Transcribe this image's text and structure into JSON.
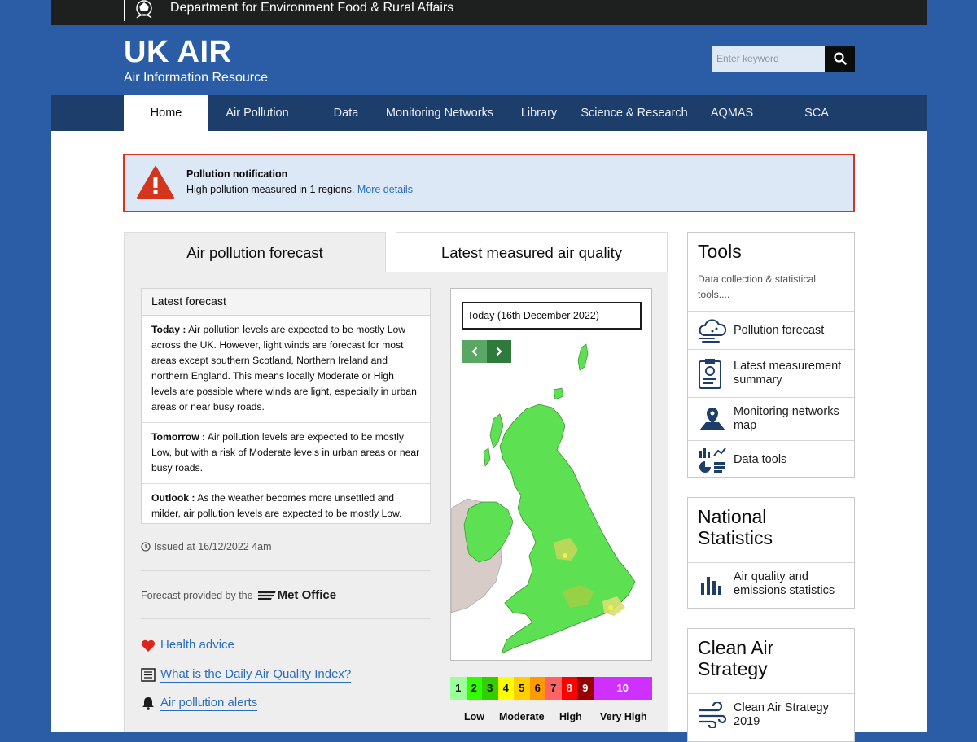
{
  "topbar": {
    "department": "Department for Environment Food & Rural Affairs"
  },
  "header": {
    "title": "UK AIR",
    "subtitle": "Air Information Resource",
    "search": {
      "placeholder": "Enter keyword"
    }
  },
  "nav": {
    "items": [
      {
        "label": "Home",
        "active": true
      },
      {
        "label": "Air Pollution"
      },
      {
        "label": "Data"
      },
      {
        "label": "Monitoring Networks"
      },
      {
        "label": "Library"
      },
      {
        "label": "Science & Research"
      },
      {
        "label": "AQMAS"
      },
      {
        "label": "SCA"
      }
    ]
  },
  "alert": {
    "title": "Pollution notification",
    "text": "High pollution measured in 1 regions.",
    "link": "More details"
  },
  "tabs": {
    "forecast": "Air pollution forecast",
    "latest": "Latest measured air quality"
  },
  "forecast": {
    "heading": "Latest forecast",
    "today_label": "Today :",
    "today_text": "Air pollution levels are expected to be mostly Low across the UK. However, light winds are forecast for most areas except southern Scotland, Northern Ireland and northern England. This means locally Moderate or High levels are possible where winds are light, especially in urban areas or near busy roads.",
    "tomorrow_label": "Tomorrow :",
    "tomorrow_text": "Air pollution levels are expected to be mostly Low, but with a risk of Moderate levels in urban areas or near busy roads.",
    "outlook_label": "Outlook :",
    "outlook_text": "As the weather becomes more unsettled and milder, air pollution levels are expected to be mostly Low.",
    "issued": "Issued at 16/12/2022 4am",
    "provided_by": "Forecast provided by the",
    "provider": "Met Office"
  },
  "links": {
    "health": "Health advice",
    "daqi": "What is the Daily Air Quality Index?",
    "alerts": "Air pollution alerts"
  },
  "map": {
    "date_select": "Today (16th December 2022)"
  },
  "legend": {
    "bands": [
      {
        "value": "1",
        "color": "#9cff9c"
      },
      {
        "value": "2",
        "color": "#31ff00"
      },
      {
        "value": "3",
        "color": "#31cf00"
      },
      {
        "value": "4",
        "color": "#ffff00"
      },
      {
        "value": "5",
        "color": "#ffcf00"
      },
      {
        "value": "6",
        "color": "#ff9a00"
      },
      {
        "value": "7",
        "color": "#ff6464"
      },
      {
        "value": "8",
        "color": "#ff0000"
      },
      {
        "value": "9",
        "color": "#990000"
      },
      {
        "value": "10",
        "color": "#ce30ff"
      }
    ],
    "labels": {
      "low": "Low",
      "moderate": "Moderate",
      "high": "High",
      "very_high": "Very High"
    }
  },
  "tools": {
    "title": "Tools",
    "subtitle": "Data collection & statistical tools....",
    "items": [
      {
        "label": "Pollution forecast"
      },
      {
        "label": "Latest measurement summary"
      },
      {
        "label": "Monitoring networks map"
      },
      {
        "label": "Data tools"
      }
    ]
  },
  "national_statistics": {
    "title": "National Statistics",
    "item": "Air quality and emissions statistics"
  },
  "clean_air": {
    "title": "Clean Air Strategy",
    "item": "Clean Air Strategy 2019"
  },
  "colors": {
    "background_blue": "#2a5da5",
    "nav_dark": "#1d3d6b",
    "alert_border": "#d4351c",
    "link_blue": "#2a6ebb"
  }
}
